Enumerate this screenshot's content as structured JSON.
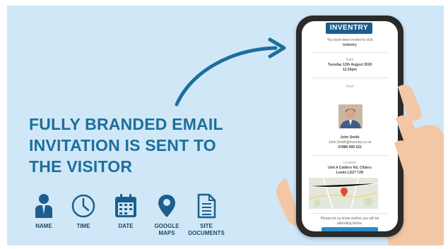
{
  "headline": {
    "line1": "FULLY BRANDED EMAIL",
    "line2": "INVITATION IS SENT TO",
    "line3": "THE VISITOR"
  },
  "features": [
    {
      "icon": "person-icon",
      "label": "NAME"
    },
    {
      "icon": "clock-icon",
      "label": "TIME"
    },
    {
      "icon": "calendar-icon",
      "label": "DATE"
    },
    {
      "icon": "map-pin-icon",
      "label": "GOOGLE MAPS"
    },
    {
      "icon": "document-icon",
      "label": "SITE DOCUMENTS"
    }
  ],
  "email": {
    "logo": "INVENTRY",
    "intro_line1": "You have been invited to visit",
    "intro_line2": "InVentry",
    "date_label": "Date",
    "date_value": "Tuesday 12th August 2020",
    "time_value": "12.30pm",
    "host_label": "Host",
    "host_name": "John Smith",
    "host_email": "John.Smith@inventry.co.uk",
    "host_phone": "07888 999 222",
    "location_label": "Location",
    "location_line1": "Unit A Calders Rd, Cliders",
    "location_line2": "Leeds LS27 7JN",
    "footer_line1": "Please let us know wether you will be",
    "footer_line2": "attending below."
  },
  "colors": {
    "background": "#cfe7f7",
    "headline": "#1d6f9b",
    "icon": "#1d5e8c",
    "logo_bg": "#1d5e8c",
    "arrow": "#1d6f9b"
  }
}
